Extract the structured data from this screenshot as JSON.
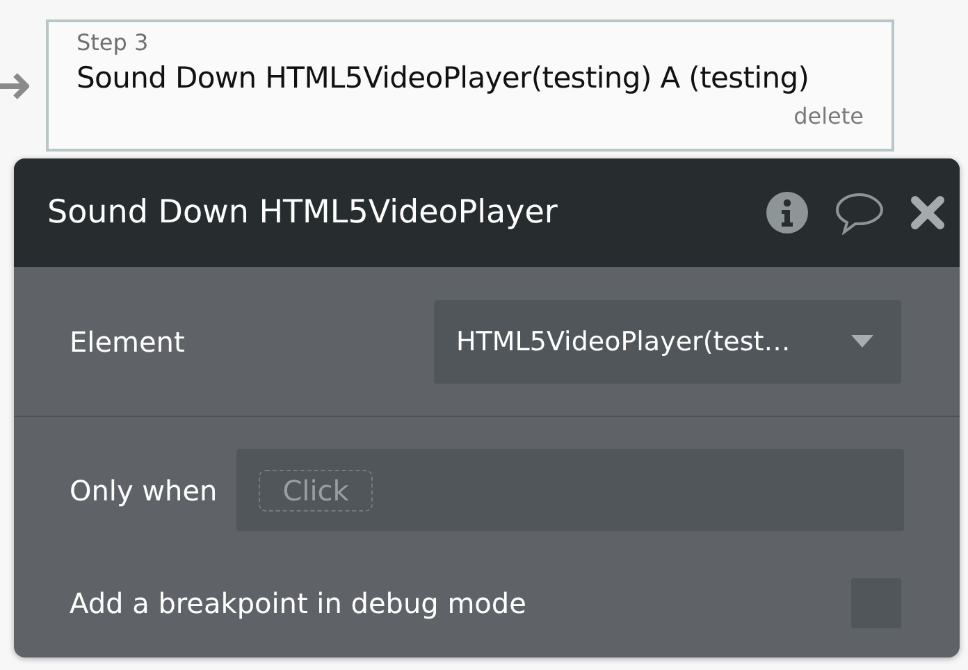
{
  "step_card": {
    "step_label": "Step 3",
    "title": "Sound Down HTML5VideoPlayer(testing) A (testing)",
    "delete_link": "delete"
  },
  "panel": {
    "title": "Sound Down HTML5VideoPlayer",
    "element_field": {
      "label": "Element",
      "value": "HTML5VideoPlayer(test…"
    },
    "only_when_field": {
      "label": "Only when",
      "placeholder": "Click"
    },
    "breakpoint": {
      "label": "Add a breakpoint in debug mode",
      "checked": false
    }
  }
}
